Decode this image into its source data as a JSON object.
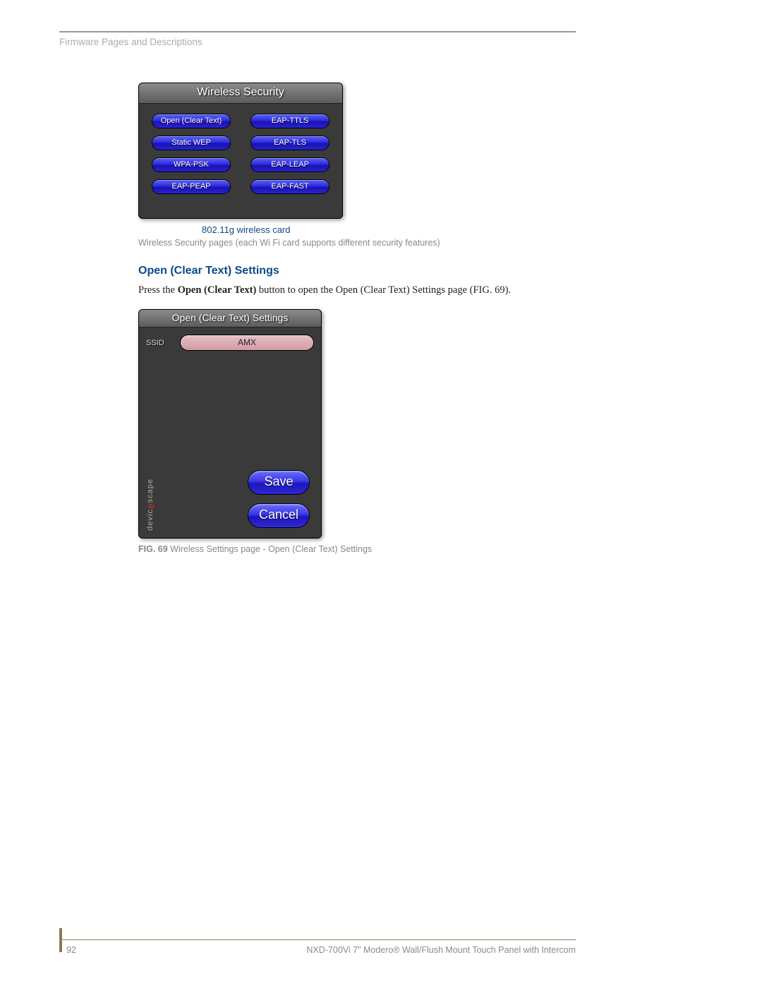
{
  "header": {
    "section": "Firmware Pages and Descriptions"
  },
  "wireless_security": {
    "title": "Wireless Security",
    "buttons_left": [
      "Open (Clear Text)",
      "Static WEP",
      "WPA-PSK",
      "EAP-PEAP"
    ],
    "buttons_right": [
      "EAP-TTLS",
      "EAP-TLS",
      "EAP-LEAP",
      "EAP-FAST"
    ],
    "caption": "802.11g wireless card",
    "note": "Wireless Security pages (each Wi Fi card supports different security features)"
  },
  "section_heading": "Open (Clear Text) Settings",
  "body": {
    "prefix": "Press the ",
    "bold": "Open (Clear Text)",
    "suffix": " button to open the Open (Clear Text) Settings page (FIG. 69)."
  },
  "open_clear_text": {
    "title": "Open (Clear Text) Settings",
    "ssid_label": "SSID",
    "ssid_value": "AMX",
    "save": "Save",
    "cancel": "Cancel",
    "brand_a": "devic",
    "brand_e": "e",
    "brand_b": "scape"
  },
  "figure": {
    "num": "FIG. 69",
    "text": "  Wireless Settings page - Open (Clear Text) Settings"
  },
  "footer": {
    "page": "92",
    "product": "NXD-700Vi 7\" Modero® Wall/Flush Mount Touch Panel with Intercom"
  }
}
